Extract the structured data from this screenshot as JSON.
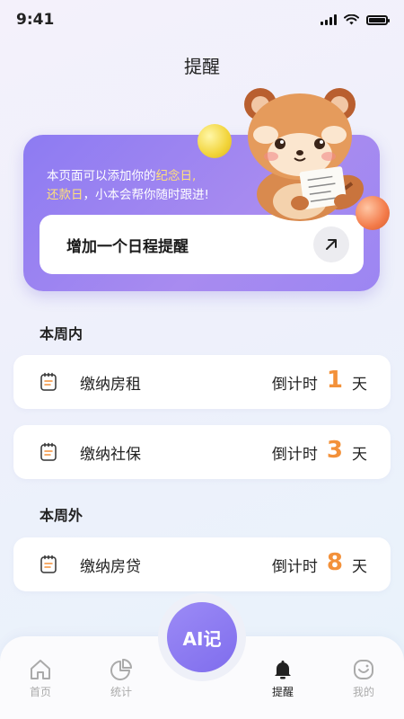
{
  "status": {
    "time": "9:41"
  },
  "header": {
    "title": "提醒"
  },
  "banner": {
    "text_prefix": "本页面可以添加你的",
    "highlight_1": "纪念日",
    "comma_1": ",",
    "highlight_2": "还款日",
    "text_suffix": "，小本会帮你随时跟进!",
    "button_label": "增加一个日程提醒",
    "mascot_icon": "red-panda-mascot"
  },
  "sections": [
    {
      "title": "本周内",
      "items": [
        {
          "name": "缴纳房租",
          "countdown_label": "倒计时",
          "days": "1",
          "unit": "天"
        },
        {
          "name": "缴纳社保",
          "countdown_label": "倒计时",
          "days": "3",
          "unit": "天"
        }
      ]
    },
    {
      "title": "本周外",
      "items": [
        {
          "name": "缴纳房贷",
          "countdown_label": "倒计时",
          "days": "8",
          "unit": "天"
        }
      ]
    }
  ],
  "tabbar": {
    "ai_label": "AI记",
    "tabs": [
      {
        "label": "首页",
        "icon": "home-icon"
      },
      {
        "label": "统计",
        "icon": "pie-chart-icon"
      },
      {
        "label": "提醒",
        "icon": "bell-icon",
        "active": true
      },
      {
        "label": "我的",
        "icon": "profile-icon"
      }
    ]
  },
  "colors": {
    "accent": "#8d7bf2",
    "countdown": "#f3913a",
    "highlight": "#ffe17a"
  }
}
